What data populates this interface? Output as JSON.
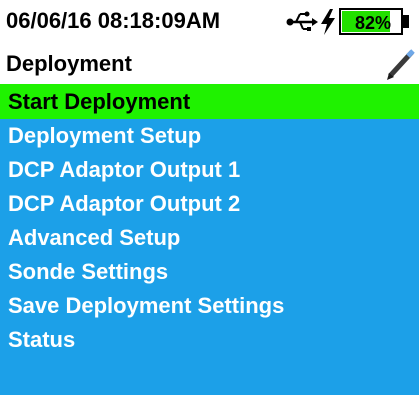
{
  "status_bar": {
    "datetime": "06/06/16  08:18:09AM",
    "usb_icon": "usb-icon",
    "charge_icon": "lightning-icon",
    "battery_percent": "82%",
    "battery_level": 0.82,
    "battery_color": "#22e000"
  },
  "header": {
    "title": "Deployment",
    "edit_icon": "pen-icon"
  },
  "menu": {
    "background_color": "#1ca0e8",
    "selected_color": "#1ff200",
    "items": [
      {
        "label": "Start Deployment",
        "selected": true
      },
      {
        "label": "Deployment Setup",
        "selected": false
      },
      {
        "label": "DCP Adaptor Output 1",
        "selected": false
      },
      {
        "label": "DCP Adaptor Output 2",
        "selected": false
      },
      {
        "label": "Advanced Setup",
        "selected": false
      },
      {
        "label": "Sonde Settings",
        "selected": false
      },
      {
        "label": "Save Deployment Settings",
        "selected": false
      },
      {
        "label": "Status",
        "selected": false
      }
    ]
  }
}
